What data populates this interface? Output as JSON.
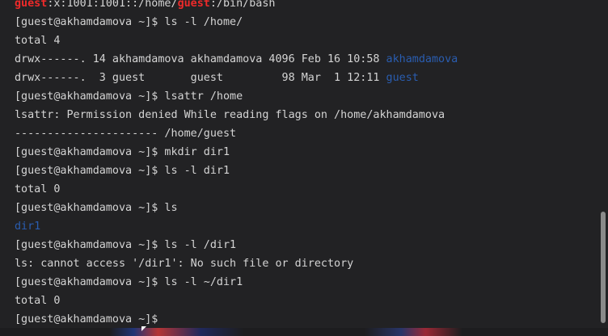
{
  "terminal": {
    "lines": [
      {
        "segments": [
          {
            "text": "guest",
            "style": "red"
          },
          {
            "text": ":x:1001:1001::/home/",
            "style": "normal"
          },
          {
            "text": "guest",
            "style": "red"
          },
          {
            "text": ":/bin/bash",
            "style": "normal"
          }
        ]
      },
      {
        "segments": [
          {
            "text": "[guest@akhamdamova ~]$ ls -l /home/",
            "style": "normal"
          }
        ]
      },
      {
        "segments": [
          {
            "text": "total 4",
            "style": "normal"
          }
        ]
      },
      {
        "segments": [
          {
            "text": "drwx------. 14 akhamdamova akhamdamova 4096 Feb 16 10:58 ",
            "style": "normal"
          },
          {
            "text": "akhamdamova",
            "style": "blue"
          }
        ]
      },
      {
        "segments": [
          {
            "text": "drwx------.  3 guest       guest         98 Mar  1 12:11 ",
            "style": "normal"
          },
          {
            "text": "guest",
            "style": "blue"
          }
        ]
      },
      {
        "segments": [
          {
            "text": "[guest@akhamdamova ~]$ lsattr /home",
            "style": "normal"
          }
        ]
      },
      {
        "segments": [
          {
            "text": "lsattr: Permission denied While reading flags on /home/akhamdamova",
            "style": "normal"
          }
        ]
      },
      {
        "segments": [
          {
            "text": "---------------------- /home/guest",
            "style": "normal"
          }
        ]
      },
      {
        "segments": [
          {
            "text": "[guest@akhamdamova ~]$ mkdir dir1",
            "style": "normal"
          }
        ]
      },
      {
        "segments": [
          {
            "text": "[guest@akhamdamova ~]$ ls -l dir1",
            "style": "normal"
          }
        ]
      },
      {
        "segments": [
          {
            "text": "total 0",
            "style": "normal"
          }
        ]
      },
      {
        "segments": [
          {
            "text": "[guest@akhamdamova ~]$ ls",
            "style": "normal"
          }
        ]
      },
      {
        "segments": [
          {
            "text": "dir1",
            "style": "blue"
          }
        ]
      },
      {
        "segments": [
          {
            "text": "[guest@akhamdamova ~]$ ls -l /dir1",
            "style": "normal"
          }
        ]
      },
      {
        "segments": [
          {
            "text": "ls: cannot access '/dir1': No such file or directory",
            "style": "normal"
          }
        ]
      },
      {
        "segments": [
          {
            "text": "[guest@akhamdamova ~]$ ls -l ~/dir1",
            "style": "normal"
          }
        ]
      },
      {
        "segments": [
          {
            "text": "total 0",
            "style": "normal"
          }
        ]
      },
      {
        "segments": [
          {
            "text": "[guest@akhamdamova ~]$ ",
            "style": "normal"
          }
        ]
      }
    ]
  },
  "colors": {
    "background": "#222224",
    "text": "#d4d4d4",
    "highlight_red": "#ee2a2a",
    "directory_blue": "#2a5db0"
  }
}
